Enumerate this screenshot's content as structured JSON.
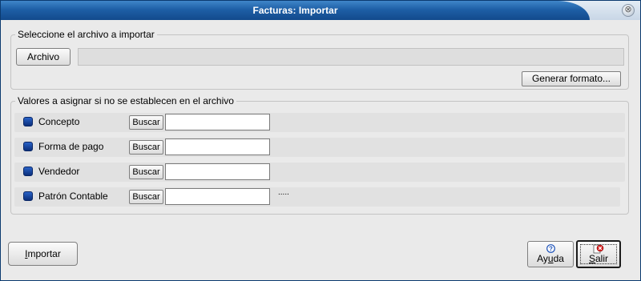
{
  "window": {
    "title": "Facturas: Importar",
    "close_glyph": "⊗"
  },
  "file_group": {
    "legend": "Seleccione el archivo a importar",
    "archivo_button": "Archivo",
    "file_path": "",
    "generar_button": "Generar formato..."
  },
  "values_group": {
    "legend": "Valores a asignar si no se establecen en el archivo",
    "rows": [
      {
        "label": "Concepto",
        "button": "Buscar",
        "value": "",
        "extra": ""
      },
      {
        "label": "Forma de pago",
        "button": "Buscar",
        "value": "",
        "extra": ""
      },
      {
        "label": "Vendedor",
        "button": "Buscar",
        "value": "",
        "extra": ""
      },
      {
        "label": "Patrón Contable",
        "button": "Buscar",
        "value": "",
        "extra": "....."
      }
    ]
  },
  "footer": {
    "importar": {
      "mnemonic": "I",
      "rest": "mportar"
    },
    "ayuda": {
      "icon": "help-icon",
      "pre": "Ay",
      "mnemonic": "u",
      "post": "da"
    },
    "salir": {
      "icon": "exit-icon",
      "mnemonic": "S",
      "rest": "alir"
    }
  }
}
